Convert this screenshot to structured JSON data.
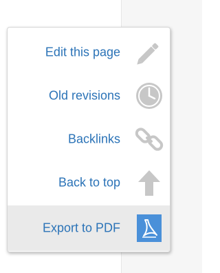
{
  "page_tools": {
    "items": [
      {
        "label": "Edit this page",
        "icon": "pencil-icon"
      },
      {
        "label": "Old revisions",
        "icon": "clock-icon"
      },
      {
        "label": "Backlinks",
        "icon": "chain-link-icon"
      },
      {
        "label": "Back to top",
        "icon": "arrow-up-icon"
      },
      {
        "label": "Export to PDF",
        "icon": "pdf-icon"
      }
    ],
    "highlighted_index": 4
  },
  "colors": {
    "link": "#2b73b7",
    "icon_gray": "#c7c7c7",
    "pdf_blue": "#4a90d9",
    "highlight": "#eaeaea"
  }
}
